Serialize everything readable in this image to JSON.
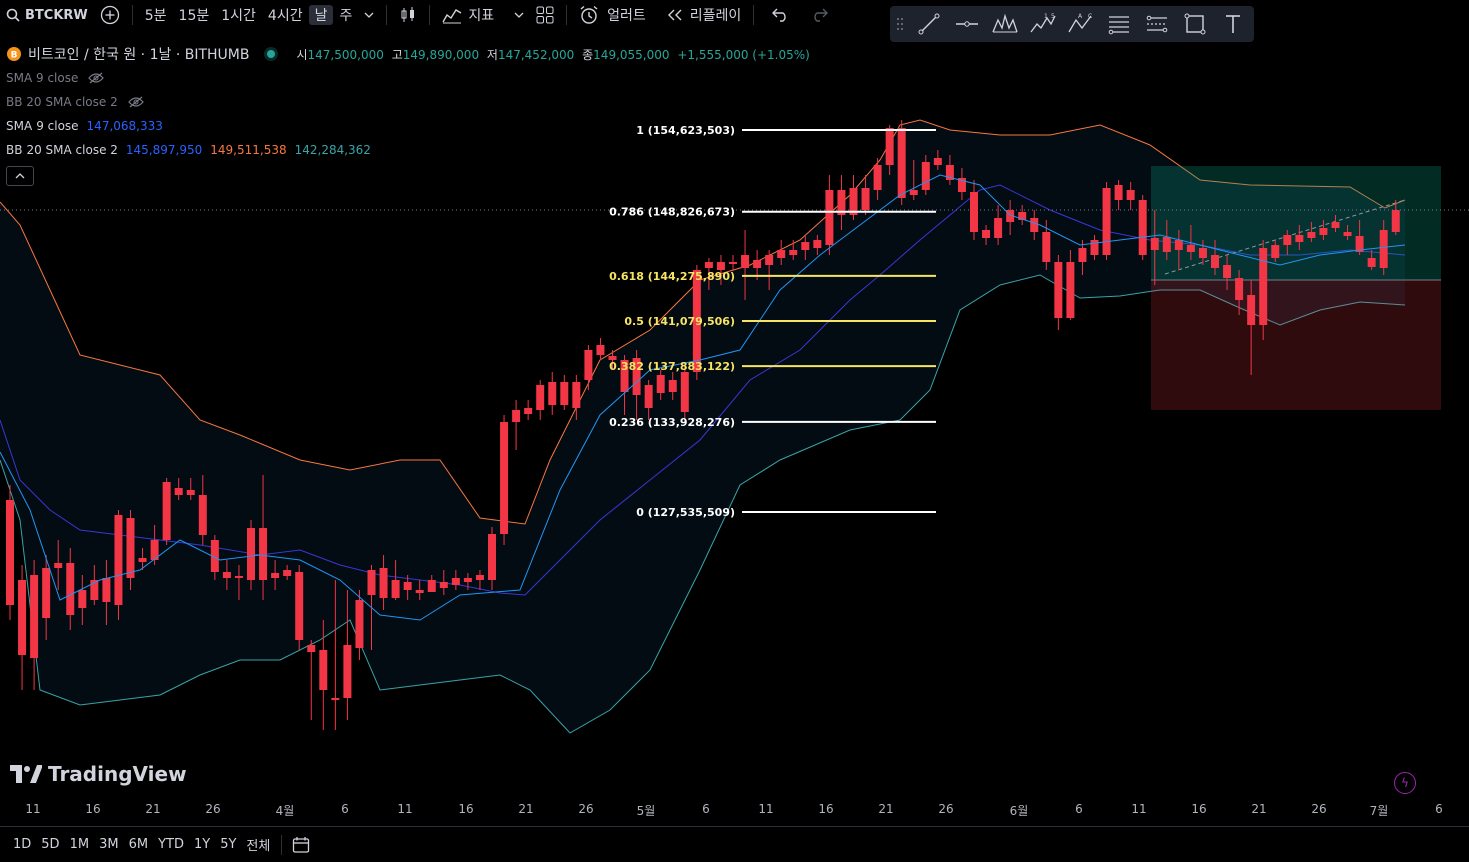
{
  "toolbar": {
    "symbol": "BTCKRW",
    "intervals": [
      "5분",
      "15분",
      "1시간",
      "4시간",
      "날",
      "주"
    ],
    "indicators_label": "지표",
    "alert_label": "얼러트",
    "replay_label": "리플레이"
  },
  "legend": {
    "title": "비트코인 / 한국 원 · 1날 · BITHUMB",
    "open_label": "시",
    "open": "147,500,000",
    "high_label": "고",
    "high": "149,890,000",
    "low_label": "저",
    "low": "147,452,000",
    "close_label": "종",
    "close": "149,055,000",
    "change": "+1,555,000 (+1.05%)",
    "hidden_sma": "SMA 9 close",
    "hidden_bb": "BB 20 SMA close 2",
    "sma_name": "SMA",
    "sma_params": "9 close",
    "sma_value": "147,068,333",
    "bb_name": "BB",
    "bb_params": "20 SMA close 2",
    "bb_basis": "145,897,950",
    "bb_upper": "149,511,538",
    "bb_lower": "142,284,362"
  },
  "fib_levels": [
    {
      "ratio": 1,
      "label": "1 (154,623,503)",
      "color": "#ffffff"
    },
    {
      "ratio": 0.786,
      "label": "0.786 (148,826,673)",
      "color": "#ffffff"
    },
    {
      "ratio": 0.618,
      "label": "0.618 (144,275,890)",
      "color": "#f7e463"
    },
    {
      "ratio": 0.5,
      "label": "0.5 (141,079,506)",
      "color": "#f7e463"
    },
    {
      "ratio": 0.382,
      "label": "0.382 (137,883,122)",
      "color": "#f7e463"
    },
    {
      "ratio": 0.236,
      "label": "0.236 (133,928,276)",
      "color": "#ffffff"
    },
    {
      "ratio": 0,
      "label": "0 (127,535,509)",
      "color": "#ffffff"
    }
  ],
  "time_labels": [
    "11",
    "16",
    "21",
    "26",
    "4월",
    "6",
    "11",
    "16",
    "21",
    "26",
    "5월",
    "6",
    "11",
    "16",
    "21",
    "26",
    "6월",
    "6",
    "11",
    "16",
    "21",
    "26",
    "7월",
    "6"
  ],
  "brand": "TradingView",
  "ranges": [
    "1D",
    "5D",
    "1M",
    "3M",
    "6M",
    "YTD",
    "1Y",
    "5Y",
    "전체"
  ],
  "colors": {
    "up": "#26a69a",
    "down": "#f23645",
    "upper": "#f7773f",
    "basis": "#2d2dcf",
    "lower": "#3aa3a8",
    "sma": "#2196f3"
  }
}
